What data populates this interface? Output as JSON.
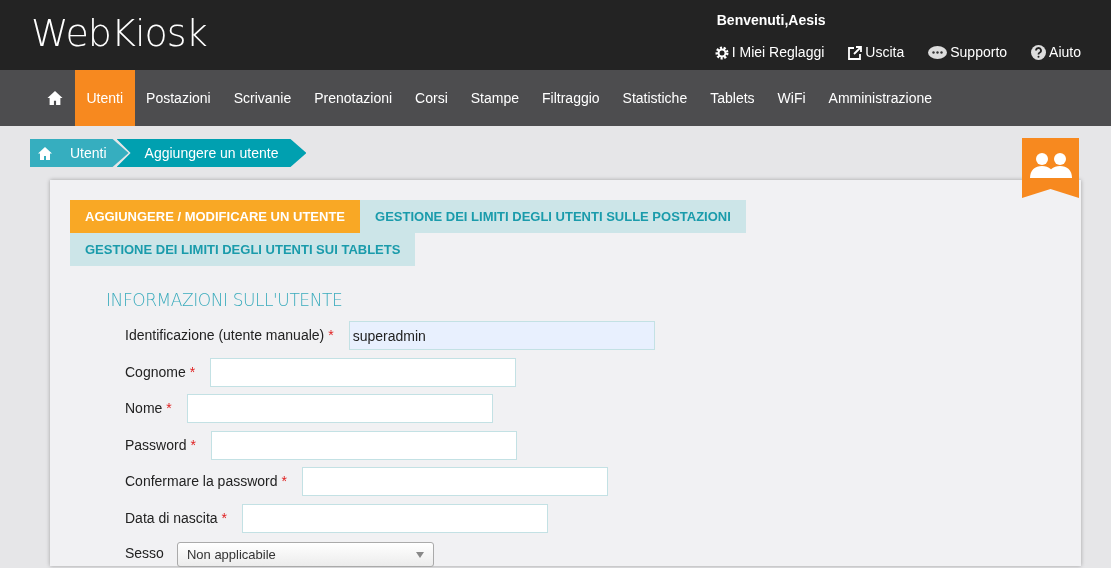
{
  "header": {
    "logo": "WebKiosk",
    "welcome": "Benvenuti,Aesis",
    "links": [
      {
        "kind": "gear",
        "label": "I Miei Reglaggi"
      },
      {
        "kind": "exit",
        "label": "Uscita"
      },
      {
        "kind": "chat",
        "label": "Supporto"
      },
      {
        "kind": "help",
        "label": "Aiuto"
      }
    ]
  },
  "nav": [
    {
      "label": "Utenti",
      "selected": true
    },
    {
      "label": "Postazioni",
      "selected": false
    },
    {
      "label": "Scrivanie",
      "selected": false
    },
    {
      "label": "Prenotazioni",
      "selected": false
    },
    {
      "label": "Corsi",
      "selected": false
    },
    {
      "label": "Stampe",
      "selected": false
    },
    {
      "label": "Filtraggio",
      "selected": false
    },
    {
      "label": "Statistiche",
      "selected": false
    },
    {
      "label": "Tablets",
      "selected": false
    },
    {
      "label": "WiFi",
      "selected": false
    },
    {
      "label": "Amministrazione",
      "selected": false
    }
  ],
  "breadcrumb": [
    "Utenti",
    "Aggiungere un utente"
  ],
  "tabs": [
    {
      "label": "AGGIUNGERE / MODIFICARE UN UTENTE",
      "selected": true
    },
    {
      "label": "GESTIONE DEI LIMITI DEGLI UTENTI SULLE POSTAZIONI",
      "selected": false
    },
    {
      "label": "GESTIONE DEI LIMITI DEGLI UTENTI SUI TABLETS",
      "selected": false
    }
  ],
  "section_title": "INFORMAZIONI SULL'UTENTE",
  "fields": [
    {
      "kind": "text",
      "label": "Identificazione (utente manuale)",
      "mark": "*",
      "value": "superadmin",
      "autofilled": true
    },
    {
      "kind": "text",
      "label": "Cognome",
      "mark": "*",
      "autofilled": false
    },
    {
      "kind": "text",
      "label": "Nome",
      "mark": "*",
      "autofilled": false
    },
    {
      "kind": "text",
      "label": "Password",
      "mark": "*",
      "autofilled": false
    },
    {
      "kind": "text",
      "label": "Confermare la password",
      "mark": "*",
      "autofilled": false
    },
    {
      "kind": "text",
      "label": "Data di nascita",
      "mark": "*",
      "autofilled": false
    },
    {
      "kind": "select",
      "label": "Sesso",
      "value": "Non applicabile"
    }
  ]
}
